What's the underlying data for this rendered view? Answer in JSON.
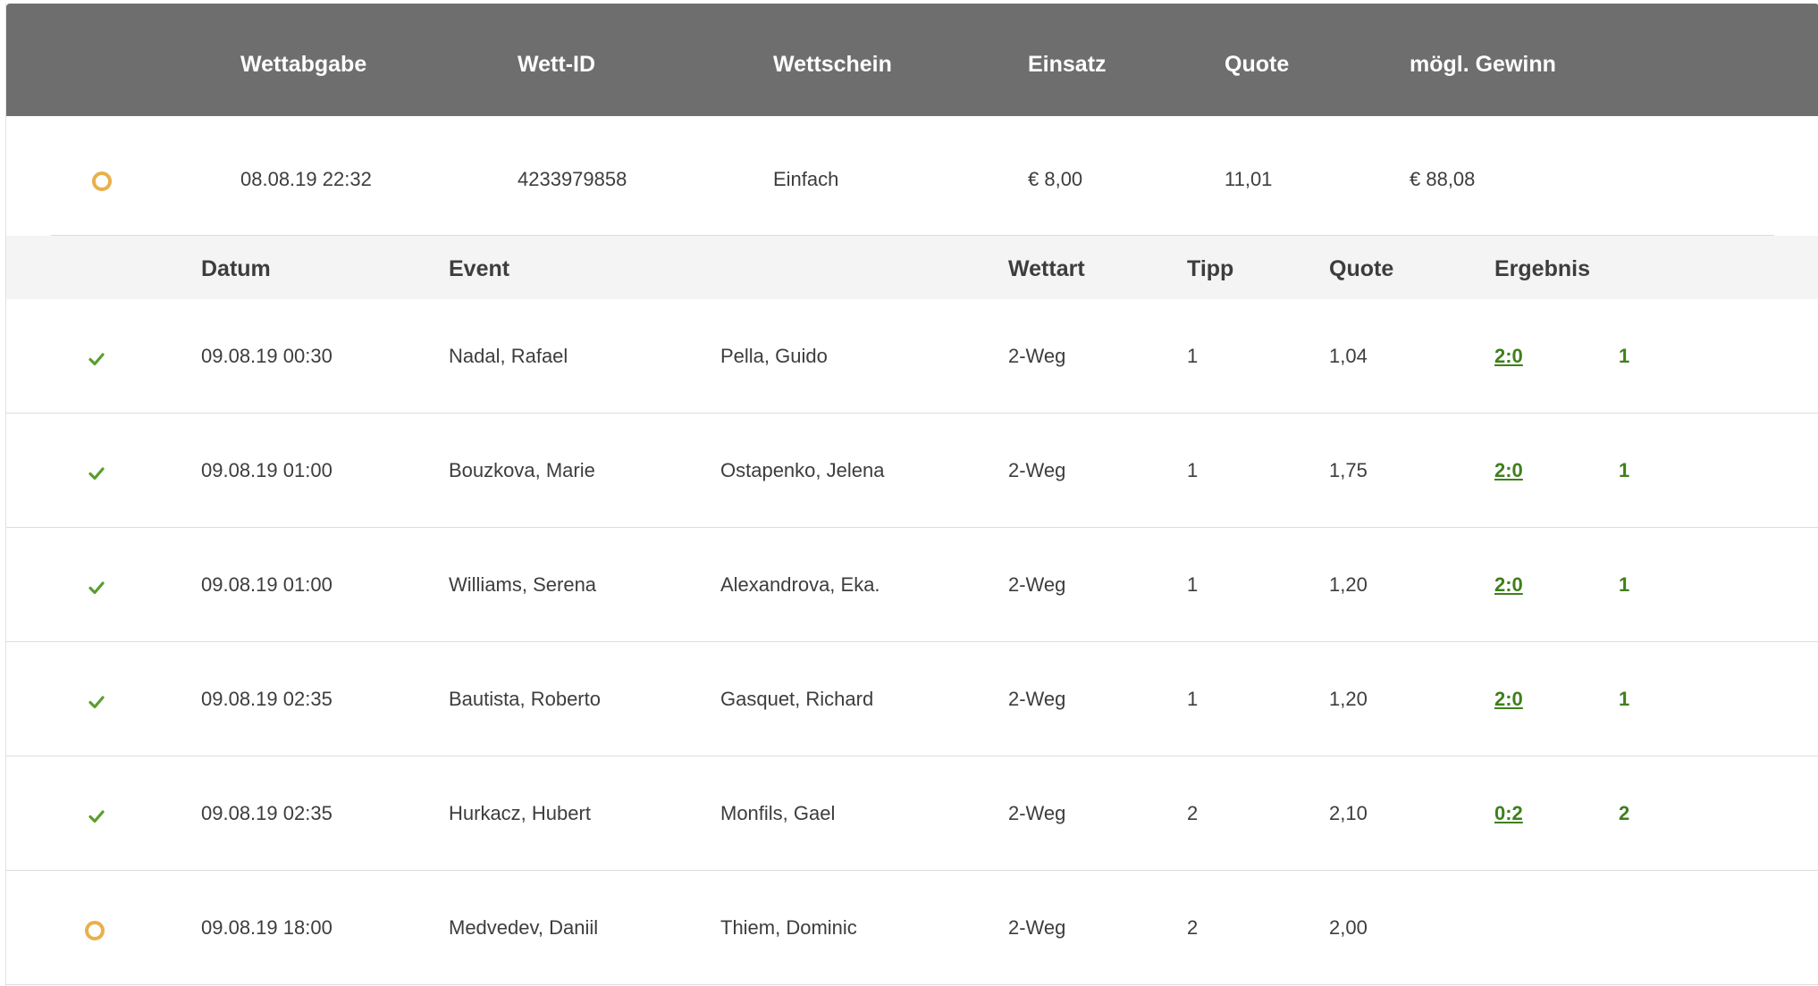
{
  "bet_header": {
    "columns": [
      "Wettabgabe",
      "Wett-ID",
      "Wettschein",
      "Einsatz",
      "Quote",
      "mögl. Gewinn"
    ]
  },
  "bet_summary": {
    "status_icon": "pending-circle-icon",
    "date": "08.08.19 22:32",
    "bet_id": "4233979858",
    "slip_type": "Einfach",
    "stake": "€ 8,00",
    "odds": "11,01",
    "potential_win": "€ 88,08"
  },
  "detail_header": {
    "columns": [
      "Datum",
      "Event",
      "Wettart",
      "Tipp",
      "Quote",
      "Ergebnis"
    ]
  },
  "detail_rows": [
    {
      "status": "won",
      "date": "09.08.19 00:30",
      "player1": "Nadal, Rafael",
      "player2": "Pella, Guido",
      "bet_type": "2-Weg",
      "tip": "1",
      "odds": "1,04",
      "score": "2:0",
      "outcome": "1"
    },
    {
      "status": "won",
      "date": "09.08.19 01:00",
      "player1": "Bouzkova, Marie",
      "player2": "Ostapenko, Jelena",
      "bet_type": "2-Weg",
      "tip": "1",
      "odds": "1,75",
      "score": "2:0",
      "outcome": "1"
    },
    {
      "status": "won",
      "date": "09.08.19 01:00",
      "player1": "Williams, Serena",
      "player2": "Alexandrova, Eka.",
      "bet_type": "2-Weg",
      "tip": "1",
      "odds": "1,20",
      "score": "2:0",
      "outcome": "1"
    },
    {
      "status": "won",
      "date": "09.08.19 02:35",
      "player1": "Bautista, Roberto",
      "player2": "Gasquet, Richard",
      "bet_type": "2-Weg",
      "tip": "1",
      "odds": "1,20",
      "score": "2:0",
      "outcome": "1"
    },
    {
      "status": "won",
      "date": "09.08.19 02:35",
      "player1": "Hurkacz, Hubert",
      "player2": "Monfils, Gael",
      "bet_type": "2-Weg",
      "tip": "2",
      "odds": "2,10",
      "score": "0:2",
      "outcome": "2"
    },
    {
      "status": "pending",
      "date": "09.08.19 18:00",
      "player1": "Medvedev, Daniil",
      "player2": "Thiem, Dominic",
      "bet_type": "2-Weg",
      "tip": "2",
      "odds": "2,00",
      "score": "",
      "outcome": ""
    }
  ],
  "colors": {
    "header_bg": "#6e6e6e",
    "subheader_bg": "#f4f4f4",
    "won_green": "#3f7f1c",
    "check_green": "#5a9e2f",
    "pending_orange": "#e9b04a"
  }
}
